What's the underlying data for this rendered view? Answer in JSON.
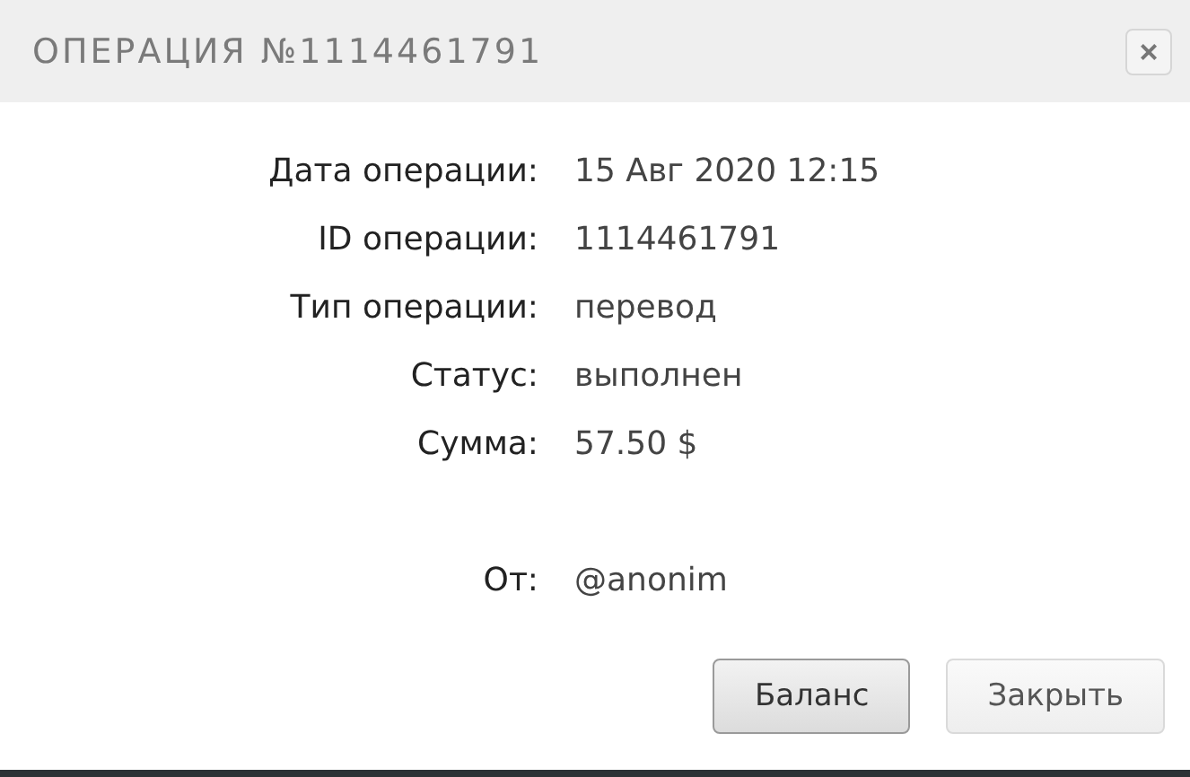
{
  "dialog": {
    "title": "ОПЕРАЦИЯ №1114461791",
    "close": "×"
  },
  "details": [
    {
      "label": "Дата операции:",
      "value": "15 Авг 2020 12:15"
    },
    {
      "label": "ID операции:",
      "value": "1114461791"
    },
    {
      "label": "Тип операции:",
      "value": "перевод"
    },
    {
      "label": "Статус:",
      "value": "выполнен"
    },
    {
      "label": "Сумма:",
      "value": "57.50 $"
    }
  ],
  "sender": {
    "label": "От:",
    "value": "@anonim"
  },
  "buttons": [
    {
      "label": "Баланс",
      "selected": true
    },
    {
      "label": "Закрыть",
      "selected": false
    }
  ]
}
